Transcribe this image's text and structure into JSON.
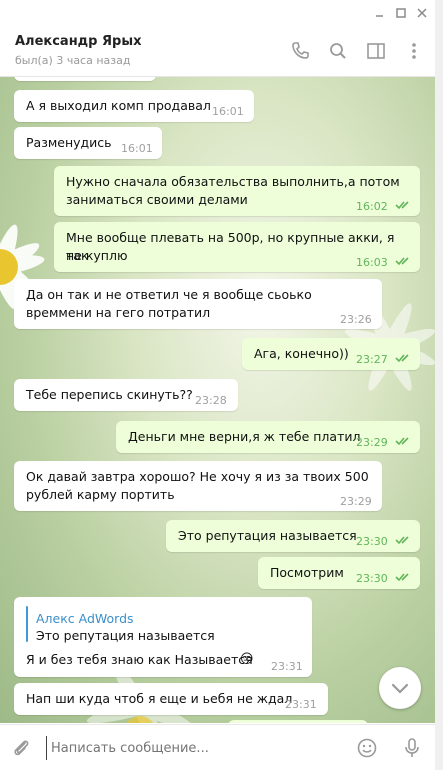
{
  "window": {
    "min_icon": "minimize-icon",
    "max_icon": "maximize-icon",
    "close_icon": "close-icon"
  },
  "header": {
    "name": "Александр Ярых",
    "status": "был(а) 3 часа назад",
    "icons": [
      "phone-icon",
      "search-icon",
      "sidebar-toggle-icon",
      "more-vertical-icon"
    ]
  },
  "messages": [
    {
      "text": "А я выходил комп продавал",
      "time": "16:01"
    },
    {
      "text": "Разменудись",
      "time": "16:01"
    },
    {
      "line1": "Нужно сначала обязательства выполнить,а потом",
      "line2": "заниматься своими делами",
      "time": "16:02"
    },
    {
      "line1": "Мне вообще плевать на 500р, но крупные акки, я так",
      "line2": "не куплю",
      "time": "16:03"
    },
    {
      "line1": "Да он так и не ответил че я воoбще сьоько",
      "line2": "времмени на гего потратил",
      "time": "23:26"
    },
    {
      "text": "Ага, конечно))",
      "time": "23:27"
    },
    {
      "text": "Тебе перепись скинуть??",
      "time": "23:28"
    },
    {
      "text": "Деньги мне верни,я ж тебе платил",
      "time": "23:29"
    },
    {
      "line1": "Ок давай завтра хорошо? Не хочу я из за твоих 500",
      "line2": "рублей карму портить",
      "time": "23:29"
    },
    {
      "text": "Это репутация называется",
      "time": "23:30"
    },
    {
      "text": "Посмотрим",
      "time": "23:30"
    },
    {
      "quote_author": "Алекс AdWords",
      "quote_text": "Это репутация называется",
      "text": "Я и без тебя знаю как Называется",
      "emoji": "😒",
      "time": "23:31"
    },
    {
      "text": "Нап ши куда чтоб я еще и ьебя не ждал",
      "time": "23:31"
    }
  ],
  "composer": {
    "placeholder": "Написать сообщение...",
    "icons": [
      "attach-icon",
      "emoji-icon",
      "microphone-icon"
    ]
  },
  "scroll_button_icon": "chevron-down-icon",
  "colors": {
    "incoming": "#ffffff",
    "outgoing": "#eefed9",
    "accent": "#3a8fc9",
    "read_ticks": "#61b55a"
  }
}
